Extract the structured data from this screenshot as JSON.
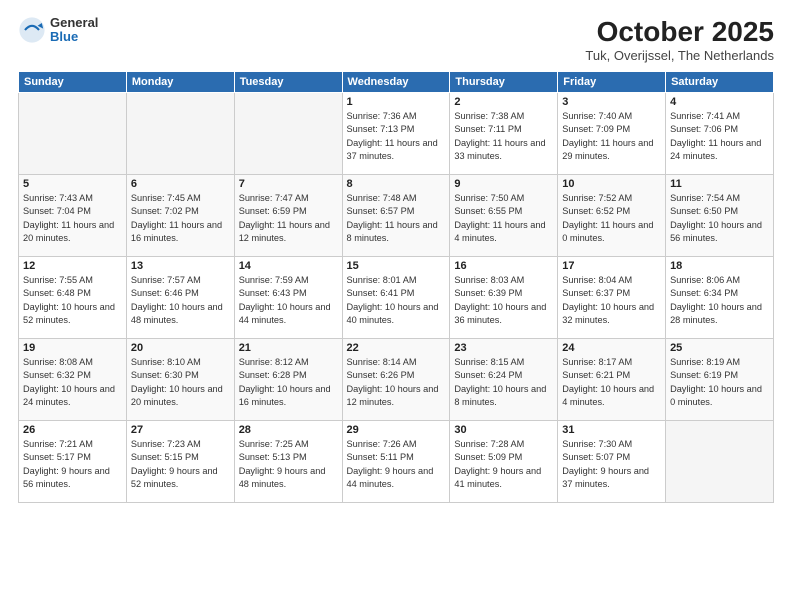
{
  "logo": {
    "general": "General",
    "blue": "Blue"
  },
  "header": {
    "month": "October 2025",
    "location": "Tuk, Overijssel, The Netherlands"
  },
  "weekdays": [
    "Sunday",
    "Monday",
    "Tuesday",
    "Wednesday",
    "Thursday",
    "Friday",
    "Saturday"
  ],
  "weeks": [
    [
      {
        "day": "",
        "empty": true
      },
      {
        "day": "",
        "empty": true
      },
      {
        "day": "",
        "empty": true
      },
      {
        "day": "1",
        "sunrise": "7:36 AM",
        "sunset": "7:13 PM",
        "daylight": "11 hours and 37 minutes."
      },
      {
        "day": "2",
        "sunrise": "7:38 AM",
        "sunset": "7:11 PM",
        "daylight": "11 hours and 33 minutes."
      },
      {
        "day": "3",
        "sunrise": "7:40 AM",
        "sunset": "7:09 PM",
        "daylight": "11 hours and 29 minutes."
      },
      {
        "day": "4",
        "sunrise": "7:41 AM",
        "sunset": "7:06 PM",
        "daylight": "11 hours and 24 minutes."
      }
    ],
    [
      {
        "day": "5",
        "sunrise": "7:43 AM",
        "sunset": "7:04 PM",
        "daylight": "11 hours and 20 minutes."
      },
      {
        "day": "6",
        "sunrise": "7:45 AM",
        "sunset": "7:02 PM",
        "daylight": "11 hours and 16 minutes."
      },
      {
        "day": "7",
        "sunrise": "7:47 AM",
        "sunset": "6:59 PM",
        "daylight": "11 hours and 12 minutes."
      },
      {
        "day": "8",
        "sunrise": "7:48 AM",
        "sunset": "6:57 PM",
        "daylight": "11 hours and 8 minutes."
      },
      {
        "day": "9",
        "sunrise": "7:50 AM",
        "sunset": "6:55 PM",
        "daylight": "11 hours and 4 minutes."
      },
      {
        "day": "10",
        "sunrise": "7:52 AM",
        "sunset": "6:52 PM",
        "daylight": "11 hours and 0 minutes."
      },
      {
        "day": "11",
        "sunrise": "7:54 AM",
        "sunset": "6:50 PM",
        "daylight": "10 hours and 56 minutes."
      }
    ],
    [
      {
        "day": "12",
        "sunrise": "7:55 AM",
        "sunset": "6:48 PM",
        "daylight": "10 hours and 52 minutes."
      },
      {
        "day": "13",
        "sunrise": "7:57 AM",
        "sunset": "6:46 PM",
        "daylight": "10 hours and 48 minutes."
      },
      {
        "day": "14",
        "sunrise": "7:59 AM",
        "sunset": "6:43 PM",
        "daylight": "10 hours and 44 minutes."
      },
      {
        "day": "15",
        "sunrise": "8:01 AM",
        "sunset": "6:41 PM",
        "daylight": "10 hours and 40 minutes."
      },
      {
        "day": "16",
        "sunrise": "8:03 AM",
        "sunset": "6:39 PM",
        "daylight": "10 hours and 36 minutes."
      },
      {
        "day": "17",
        "sunrise": "8:04 AM",
        "sunset": "6:37 PM",
        "daylight": "10 hours and 32 minutes."
      },
      {
        "day": "18",
        "sunrise": "8:06 AM",
        "sunset": "6:34 PM",
        "daylight": "10 hours and 28 minutes."
      }
    ],
    [
      {
        "day": "19",
        "sunrise": "8:08 AM",
        "sunset": "6:32 PM",
        "daylight": "10 hours and 24 minutes."
      },
      {
        "day": "20",
        "sunrise": "8:10 AM",
        "sunset": "6:30 PM",
        "daylight": "10 hours and 20 minutes."
      },
      {
        "day": "21",
        "sunrise": "8:12 AM",
        "sunset": "6:28 PM",
        "daylight": "10 hours and 16 minutes."
      },
      {
        "day": "22",
        "sunrise": "8:14 AM",
        "sunset": "6:26 PM",
        "daylight": "10 hours and 12 minutes."
      },
      {
        "day": "23",
        "sunrise": "8:15 AM",
        "sunset": "6:24 PM",
        "daylight": "10 hours and 8 minutes."
      },
      {
        "day": "24",
        "sunrise": "8:17 AM",
        "sunset": "6:21 PM",
        "daylight": "10 hours and 4 minutes."
      },
      {
        "day": "25",
        "sunrise": "8:19 AM",
        "sunset": "6:19 PM",
        "daylight": "10 hours and 0 minutes."
      }
    ],
    [
      {
        "day": "26",
        "sunrise": "7:21 AM",
        "sunset": "5:17 PM",
        "daylight": "9 hours and 56 minutes."
      },
      {
        "day": "27",
        "sunrise": "7:23 AM",
        "sunset": "5:15 PM",
        "daylight": "9 hours and 52 minutes."
      },
      {
        "day": "28",
        "sunrise": "7:25 AM",
        "sunset": "5:13 PM",
        "daylight": "9 hours and 48 minutes."
      },
      {
        "day": "29",
        "sunrise": "7:26 AM",
        "sunset": "5:11 PM",
        "daylight": "9 hours and 44 minutes."
      },
      {
        "day": "30",
        "sunrise": "7:28 AM",
        "sunset": "5:09 PM",
        "daylight": "9 hours and 41 minutes."
      },
      {
        "day": "31",
        "sunrise": "7:30 AM",
        "sunset": "5:07 PM",
        "daylight": "9 hours and 37 minutes."
      },
      {
        "day": "",
        "empty": true
      }
    ]
  ]
}
